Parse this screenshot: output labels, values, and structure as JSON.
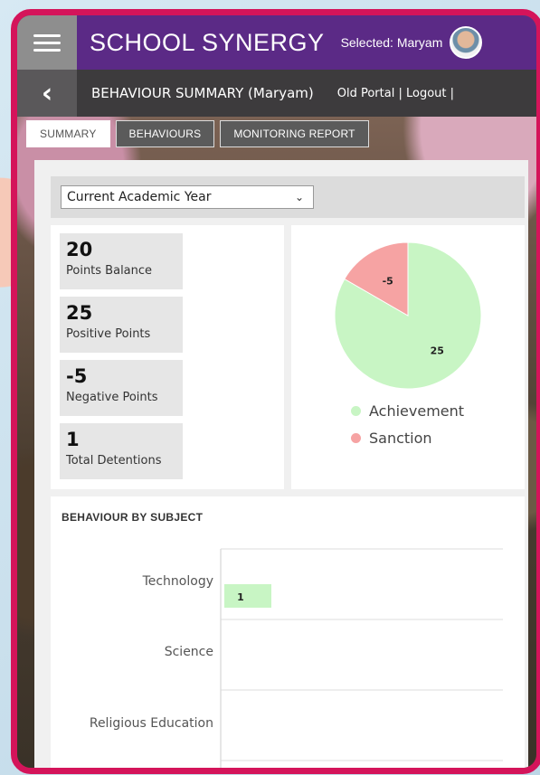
{
  "app": {
    "brand": "SCHOOL SYNERGY",
    "selected_label": "Selected: Maryam",
    "menu_icon": "hamburger-icon",
    "avatar": "student-avatar"
  },
  "subheader": {
    "back_icon": "chevron-left-icon",
    "page_title": "BEHAVIOUR SUMMARY (Maryam)",
    "links": "Old Portal | Logout |"
  },
  "tabs": [
    {
      "label": "SUMMARY",
      "active": true
    },
    {
      "label": "BEHAVIOURS",
      "active": false
    },
    {
      "label": "MONITORING REPORT",
      "active": false
    }
  ],
  "filter": {
    "selected": "Current Academic Year"
  },
  "stats": [
    {
      "value": "20",
      "label": "Points Balance"
    },
    {
      "value": "25",
      "label": "Positive Points"
    },
    {
      "value": "-5",
      "label": "Negative Points"
    },
    {
      "value": "1",
      "label": "Total Detentions"
    }
  ],
  "colors": {
    "achievement": "#c8f5c4",
    "sanction": "#f6a3a3",
    "brand_purple": "#5b2a86",
    "frame_pink": "#d4145a"
  },
  "chart_data": [
    {
      "type": "pie",
      "categories": [
        "Achievement",
        "Sanction"
      ],
      "values": [
        25,
        5
      ],
      "data_labels": [
        "25",
        "-5"
      ],
      "legend_placement": "bottom"
    },
    {
      "type": "bar",
      "orientation": "horizontal",
      "title": "BEHAVIOUR BY SUBJECT",
      "categories": [
        "Technology",
        "Science",
        "Religious Education"
      ],
      "values": [
        1,
        0,
        0
      ],
      "data_labels": [
        "1",
        "",
        ""
      ]
    }
  ]
}
